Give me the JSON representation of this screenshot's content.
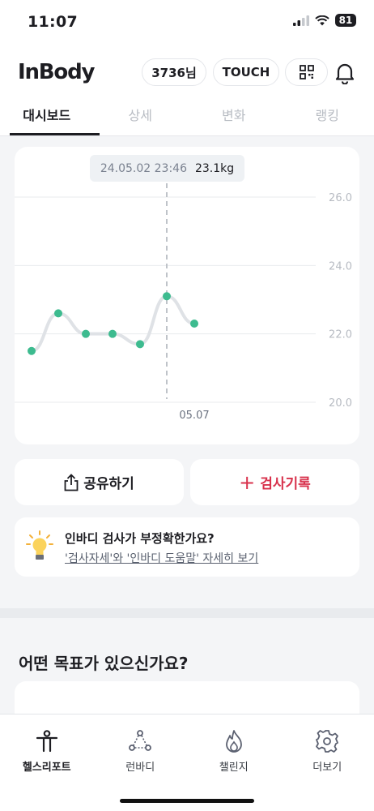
{
  "status": {
    "time": "11:07",
    "battery": "81"
  },
  "header": {
    "logo": "InBody",
    "user_pill": "3736님",
    "touch_pill": "TOUCH"
  },
  "tabs": [
    {
      "label": "대시보드",
      "active": true
    },
    {
      "label": "상세",
      "active": false
    },
    {
      "label": "변화",
      "active": false
    },
    {
      "label": "랭킹",
      "active": false
    }
  ],
  "tooltip": {
    "datetime": "24.05.02 23:46",
    "weight": "23.1kg"
  },
  "chart_data": {
    "type": "line",
    "title": "",
    "xlabel": "",
    "ylabel": "",
    "ylim": [
      20.0,
      26.0
    ],
    "yticks": [
      "26.0",
      "24.0",
      "22.0",
      "20.0"
    ],
    "xtick_labels": [
      "05.07"
    ],
    "grid": true,
    "series": [
      {
        "values": [
          21.5,
          22.6,
          22.0,
          22.0,
          21.7,
          23.1,
          22.3
        ]
      }
    ],
    "selected_index": 5,
    "colors": {
      "line": "#dfe2e6",
      "point": "#3dbb8f",
      "grid": "#e9ebee",
      "marker_line": "#bfc3c9"
    }
  },
  "actions": {
    "share_label": "공유하기",
    "record_label": "검사기록",
    "record_color": "#d8324c"
  },
  "info": {
    "title": "인바디 검사가 부정확한가요?",
    "link": "'검사자세'와 '인바디 도움말' 자세히 보기"
  },
  "goals": {
    "title": "어떤 목표가 있으신가요?"
  },
  "bottom_nav": [
    {
      "label": "헬스리포트",
      "icon": "person-icon",
      "active": true
    },
    {
      "label": "런바디",
      "icon": "runbody-icon",
      "active": false
    },
    {
      "label": "챌린지",
      "icon": "flame-icon",
      "active": false
    },
    {
      "label": "더보기",
      "icon": "gear-icon",
      "active": false
    }
  ]
}
